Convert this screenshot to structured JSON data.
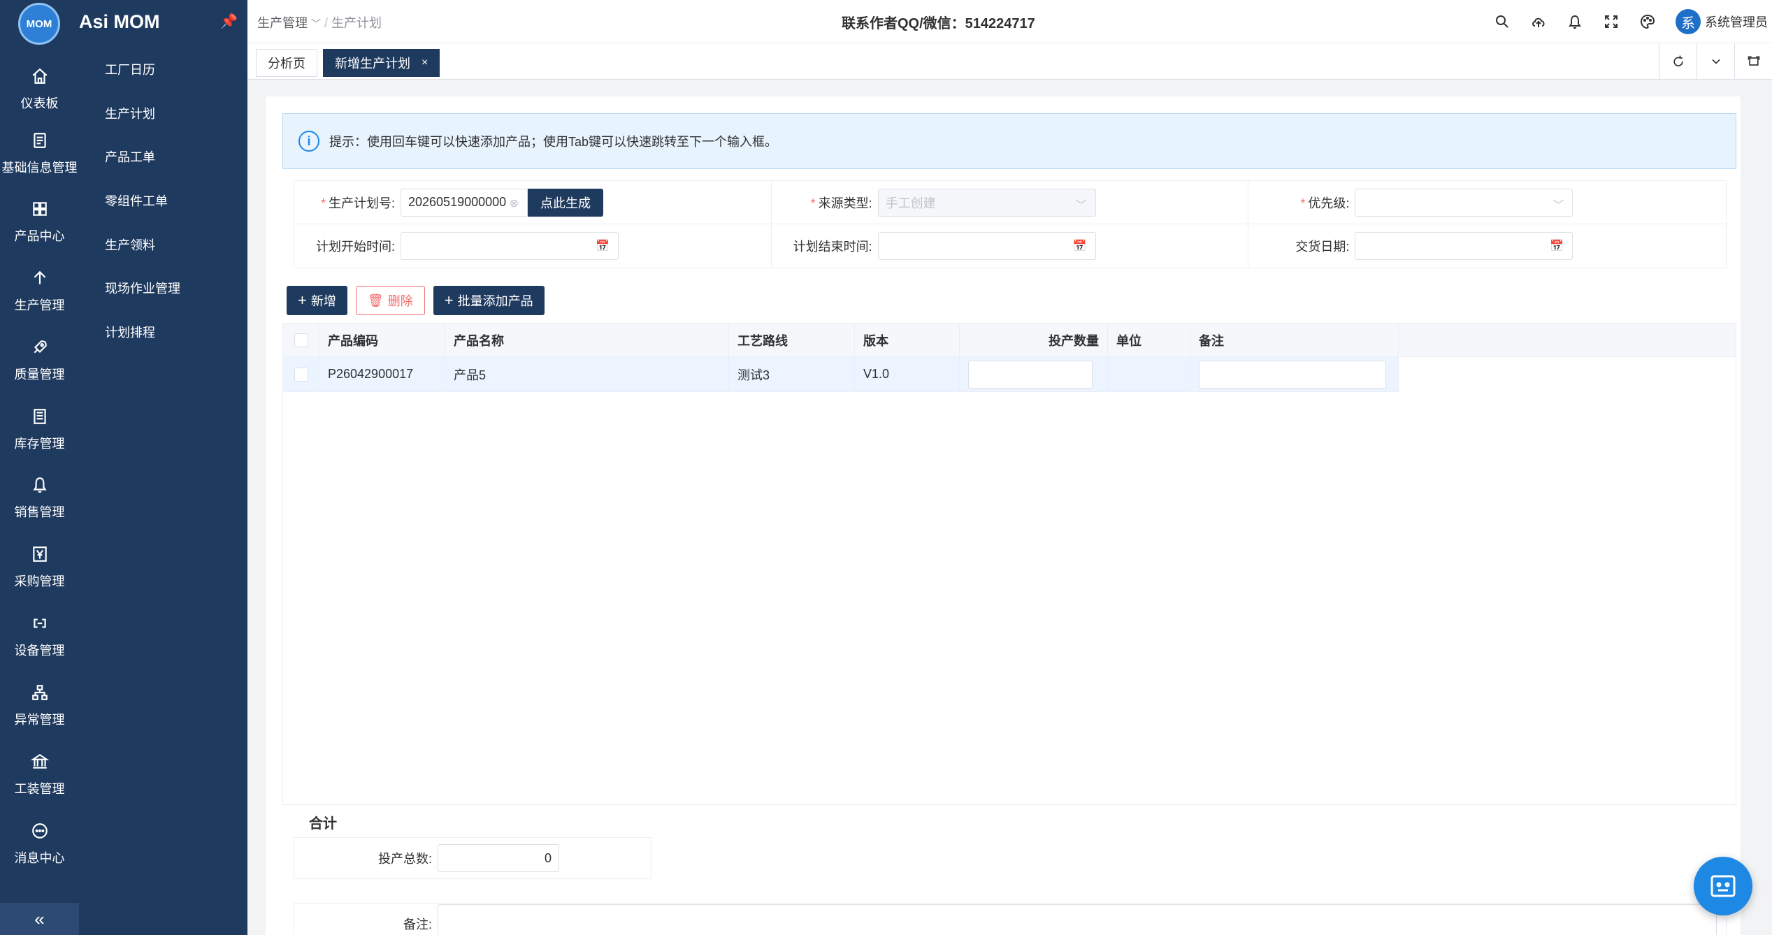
{
  "app": {
    "logo_text": "MOM",
    "title": "Asi MOM",
    "pin_icon": "pin-icon"
  },
  "rail": {
    "items": [
      {
        "label": "仪表板",
        "icon": "home-icon"
      },
      {
        "label": "基础信息管理",
        "icon": "document-icon"
      },
      {
        "label": "产品中心",
        "icon": "grid-icon"
      },
      {
        "label": "生产管理",
        "icon": "arrow-up-icon"
      },
      {
        "label": "质量管理",
        "icon": "rocket-icon"
      },
      {
        "label": "库存管理",
        "icon": "list-icon"
      },
      {
        "label": "销售管理",
        "icon": "bell-icon"
      },
      {
        "label": "采购管理",
        "icon": "yen-icon"
      },
      {
        "label": "设备管理",
        "icon": "link-icon"
      },
      {
        "label": "异常管理",
        "icon": "hierarchy-icon"
      },
      {
        "label": "工装管理",
        "icon": "bank-icon"
      },
      {
        "label": "消息中心",
        "icon": "chat-icon"
      }
    ],
    "collapse": "«"
  },
  "submenu": [
    "工厂日历",
    "生产计划",
    "产品工单",
    "零组件工单",
    "生产领料",
    "现场作业管理",
    "计划排程"
  ],
  "header": {
    "breadcrumb_parent": "生产管理",
    "breadcrumb_sep": "/",
    "breadcrumb_current": "生产计划",
    "contact": "联系作者QQ/微信：514224717",
    "avatar_text": "系",
    "username": "系统管理员"
  },
  "tabs": [
    {
      "label": "分析页"
    },
    {
      "label": "新增生产计划",
      "close": "×"
    }
  ],
  "tip": {
    "icon": "i",
    "text": "提示：使用回车键可以快速添加产品；使用Tab键可以快速跳转至下一个输入框。"
  },
  "form": {
    "plan_no_label": "生产计划号:",
    "plan_no_value": "20260519000000",
    "generate_btn": "点此生成",
    "source_label": "来源类型:",
    "source_value": "手工创建",
    "priority_label": "优先级:",
    "priority_value": "",
    "start_label": "计划开始时间:",
    "end_label": "计划结束时间:",
    "delivery_label": "交货日期:"
  },
  "buttons": {
    "add": "新增",
    "delete": "删除",
    "batch_add": "批量添加产品"
  },
  "table": {
    "headers": [
      "产品编码",
      "产品名称",
      "工艺路线",
      "版本",
      "投产数量",
      "单位",
      "备注"
    ],
    "rows": [
      {
        "code": "P26042900017",
        "name": "产品5",
        "route": "测试3",
        "version": "V1.0",
        "qty": "",
        "unit": "",
        "remark": ""
      }
    ]
  },
  "summary": {
    "title": "合计",
    "total_label": "投产总数:",
    "total_value": "0"
  },
  "remark_label": "备注:"
}
